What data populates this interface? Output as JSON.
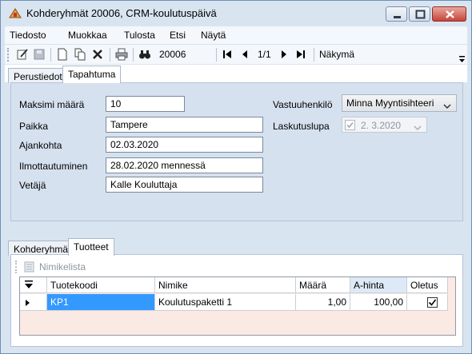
{
  "window": {
    "title": "Kohderyhmät 20006, CRM-koulutuspäivä"
  },
  "menu": {
    "items": [
      "Tiedosto",
      "Muokkaa",
      "Tulosta",
      "Etsi",
      "Näytä"
    ]
  },
  "toolbar": {
    "record_number": "20006",
    "nav_position": "1/1",
    "view_label": "Näkymä"
  },
  "tabs_top": [
    "Perustiedot",
    "Tapahtuma"
  ],
  "tabs_top_active": "Tapahtuma",
  "form": {
    "max_label": "Maksimi määrä",
    "max_value": "10",
    "place_label": "Paikka",
    "place_value": "Tampere",
    "time_label": "Ajankohta",
    "time_value": "02.03.2020",
    "registration_label": "Ilmottautuminen",
    "registration_value": "28.02.2020 mennessä",
    "leader_label": "Vetäjä",
    "leader_value": "Kalle Kouluttaja",
    "responsible_label": "Vastuuhenkilö",
    "responsible_value": "Minna Myyntisihteeri",
    "invoicing_label": "Laskutuslupa",
    "invoicing_date": "2.  3.2020",
    "invoicing_checked": true
  },
  "tabs_bottom": [
    "Kohderyhmä",
    "Tuotteet"
  ],
  "tabs_bottom_active": "Tuotteet",
  "products": {
    "toolbar_label": "Nimikelista",
    "columns": [
      "Tuotekoodi",
      "Nimike",
      "Määrä",
      "A-hinta",
      "Oletus"
    ],
    "rows": [
      {
        "code": "KP1",
        "name": "Koulutuspaketti 1",
        "qty": "1,00",
        "price": "100,00",
        "default": true
      }
    ]
  },
  "colors": {
    "accent": "#3399ff",
    "panel": "#d6e1ef",
    "frame": "#d9e4f1"
  }
}
